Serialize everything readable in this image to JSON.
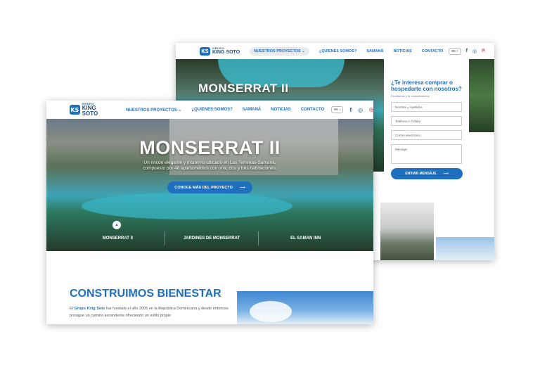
{
  "brand": {
    "logo_mark": "KS",
    "group_label": "GRUPO",
    "name": "KING SOTO"
  },
  "nav": {
    "projects": "NUESTROS PROYECTOS",
    "about": "¿QUIENES SOMOS?",
    "samana": "SAMANÁ",
    "news": "NOTICIAS",
    "contact": "CONTACTO",
    "lang": "es",
    "dropdown_icon": "chevron-down",
    "facebook": "f",
    "instagram": "◎",
    "pinterest": "℗"
  },
  "back_page": {
    "hero_title": "MONSERRAT II",
    "form": {
      "title": "¿Te interesa comprar o hospedarte con nosotros?",
      "subtitle": "Escribenos y te contactaremos",
      "name_placeholder": "Nombre y Apellidos",
      "phone_placeholder": "Teléfono o Celular",
      "email_placeholder": "Correo electrónico",
      "message_placeholder": "Mensaje",
      "submit": "ENVIAR MENSAJE"
    }
  },
  "front_page": {
    "hero_title": "MONSERRAT II",
    "hero_subtitle_1": "Un rincón elegante y moderno ubicado en Las Terrenas-Samaná,",
    "hero_subtitle_2": "compuesto por 48 apartamentos con una, dos y tres habitaciones.",
    "cta": "CONOCE MÁS DEL PROYECTO",
    "tabs": [
      "MONSERRAT II",
      "JARDINES DE MONSERRAT",
      "EL SAMAN INN"
    ],
    "section_title": "CONSTRUIMOS BIENESTAR",
    "section_text_prefix": "El ",
    "section_text_brand": "Grupo King Soto",
    "section_text_rest": " fue fundado el año 2005 en la República Dominicana y desde entonces prosigue un camino ascendente ofreciendo un estilo propio"
  },
  "colors": {
    "accent": "#1f6fbf",
    "pinterest": "#cc2a36"
  }
}
